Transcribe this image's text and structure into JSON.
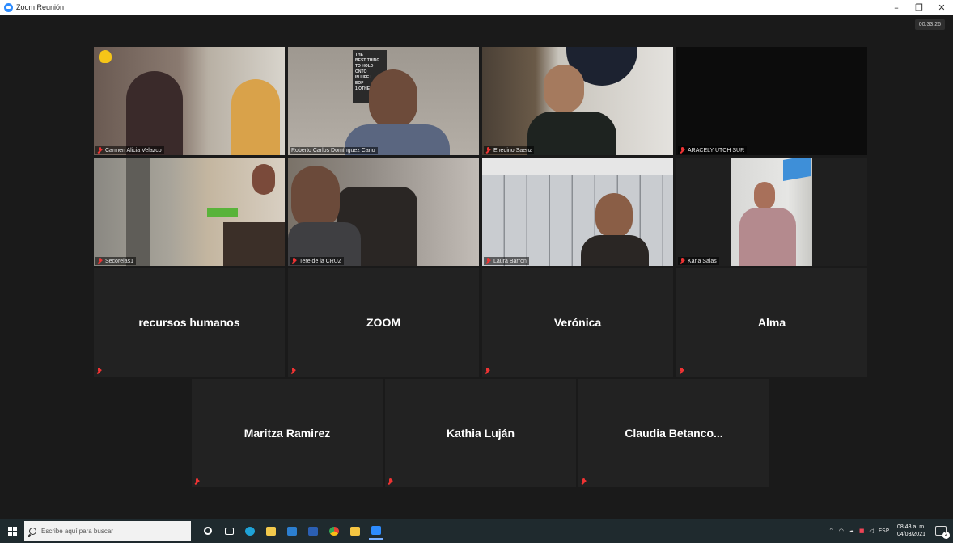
{
  "window": {
    "title": "Zoom Reunión",
    "minimize": "–",
    "restore": "❐",
    "close": "✕"
  },
  "meeting": {
    "timer": "00:33:26"
  },
  "video_tiles": [
    {
      "name": "Carmen Alicia Velazco",
      "raised_hand": true
    },
    {
      "name": "Roberto Carlos Domínguez Cano",
      "active_speaker": true,
      "poster_text": [
        "THE",
        "BEST THING",
        "TO HOLD",
        "ONTO",
        "IN LIFE I",
        "EOF",
        "1 OTHE"
      ]
    },
    {
      "name": "Enedino Saenz"
    },
    {
      "name": "ARACELY UTCH SUR"
    },
    {
      "name": "Secorelas1"
    },
    {
      "name": "Tere de la CRUZ"
    },
    {
      "name": "Laura Barron"
    },
    {
      "name": "Karla Salas"
    }
  ],
  "name_tiles_row1": [
    {
      "name": "recursos humanos"
    },
    {
      "name": "ZOOM"
    },
    {
      "name": "Verónica"
    },
    {
      "name": "Alma"
    }
  ],
  "name_tiles_row2": [
    {
      "name": "Maritza Ramirez"
    },
    {
      "name": "Kathia Luján"
    },
    {
      "name": "Claudia  Betanco..."
    }
  ],
  "taskbar": {
    "search_placeholder": "Escribe aquí para buscar",
    "apps": [
      "cortana-circle",
      "task-view",
      "edge",
      "file-explorer",
      "store",
      "word",
      "chrome",
      "sticky-notes",
      "zoom"
    ],
    "tray": {
      "caret": "^",
      "lang": "ESP",
      "time": "08:48 a. m.",
      "date": "04/03/2021",
      "notifications": "2"
    }
  },
  "colors": {
    "meeting_bg": "#1a1a1a",
    "tile_bg": "#222222",
    "active_outline": "#c9d94a",
    "muted_mic": "#e33333",
    "taskbar": "#1f2a2e"
  }
}
